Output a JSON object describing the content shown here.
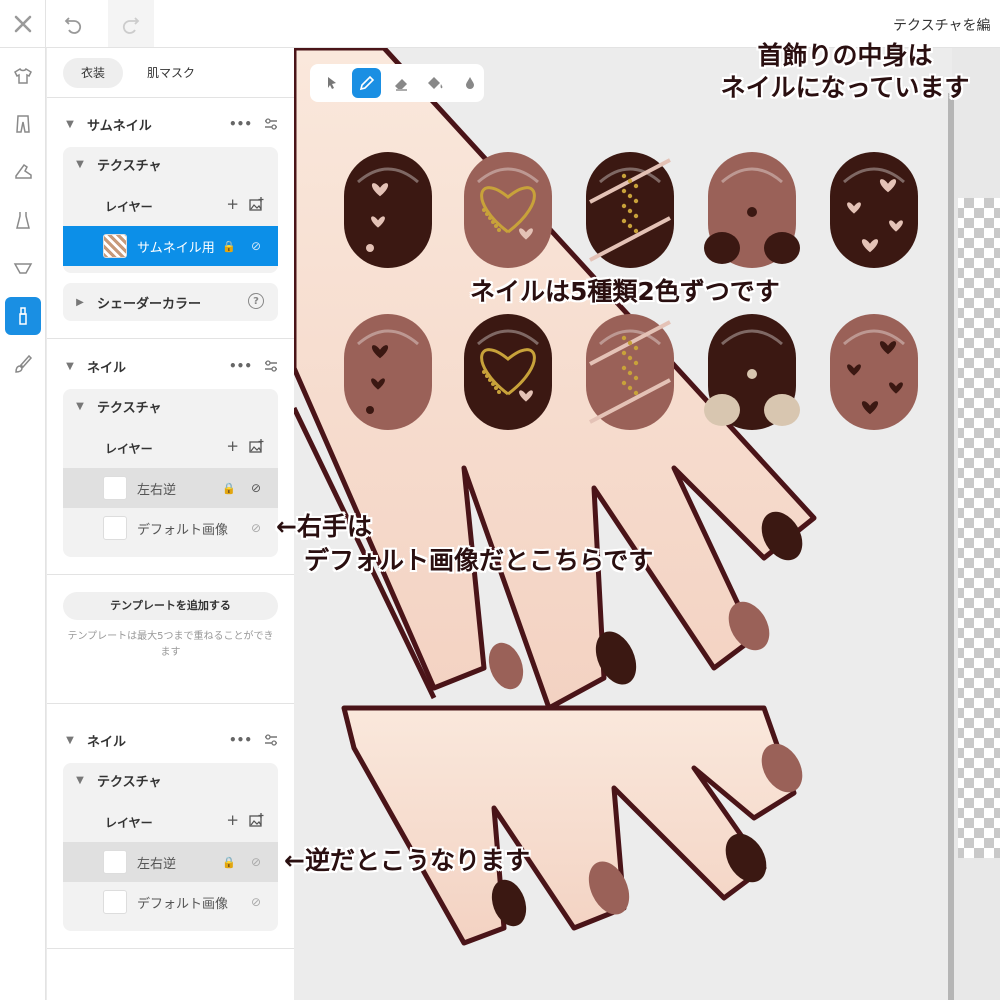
{
  "topbar": {
    "title": "テクスチャを編"
  },
  "icons": {
    "close": "close-icon",
    "undo": "undo-icon",
    "redo": "redo-icon"
  },
  "rail": [
    "shirt-icon",
    "pants-icon",
    "shoe-icon",
    "dress-icon",
    "underwear-icon",
    "nail-polish-icon",
    "brush-icon"
  ],
  "panel": {
    "tabs": [
      "衣装",
      "肌マスク"
    ],
    "sections": [
      {
        "title": "サムネイル",
        "group_title": "テクスチャ",
        "layers_label": "レイヤー",
        "layers": [
          {
            "name": "サムネイル用"
          }
        ],
        "shader_title": "シェーダーカラー",
        "help_glyph": "?"
      },
      {
        "title": "ネイル",
        "group_title": "テクスチャ",
        "layers_label": "レイヤー",
        "layers": [
          {
            "name": "左右逆"
          },
          {
            "name": "デフォルト画像"
          }
        ]
      },
      {
        "title": "ネイル",
        "group_title": "テクスチャ",
        "layers_label": "レイヤー",
        "layers": [
          {
            "name": "左右逆"
          },
          {
            "name": "デフォルト画像"
          }
        ]
      }
    ],
    "add_template_button": "テンプレートを追加する",
    "template_note": "テンプレートは最大5つまで重ねることができます"
  },
  "toolbar": {
    "tools": [
      "cursor-icon",
      "pencil-icon",
      "eraser-icon",
      "fill-icon",
      "droplet-icon"
    ],
    "active": 1
  },
  "annotations": {
    "neck_line1": "首飾りの中身は",
    "neck_line2": "ネイルになっています",
    "kinds": "ネイルは5種類2色ずつです",
    "right_hand_line1": "←右手は",
    "right_hand_line2": "デフォルト画像だとこちらです",
    "reverse": "←逆だとこうなります"
  },
  "colors": {
    "accent": "#1a8fe3",
    "nail_dark": "#3b1812",
    "nail_pink": "#9a6158",
    "gold": "#c8a23a",
    "heart_light": "#e4c2b6",
    "skin": "#f6ddd0",
    "outline": "#4a1418"
  },
  "nail_designs": [
    "light-hearts-on-dark",
    "gold-heart-outline",
    "gold-glitter-stripe",
    "dot-pattern",
    "pink-hearts-on-dark",
    "dark-hearts-on-pink",
    "gold-heart-on-dark",
    "gold-glitter-on-pink",
    "cream-dots-on-dark",
    "dark-hearts-on-pink-2"
  ]
}
